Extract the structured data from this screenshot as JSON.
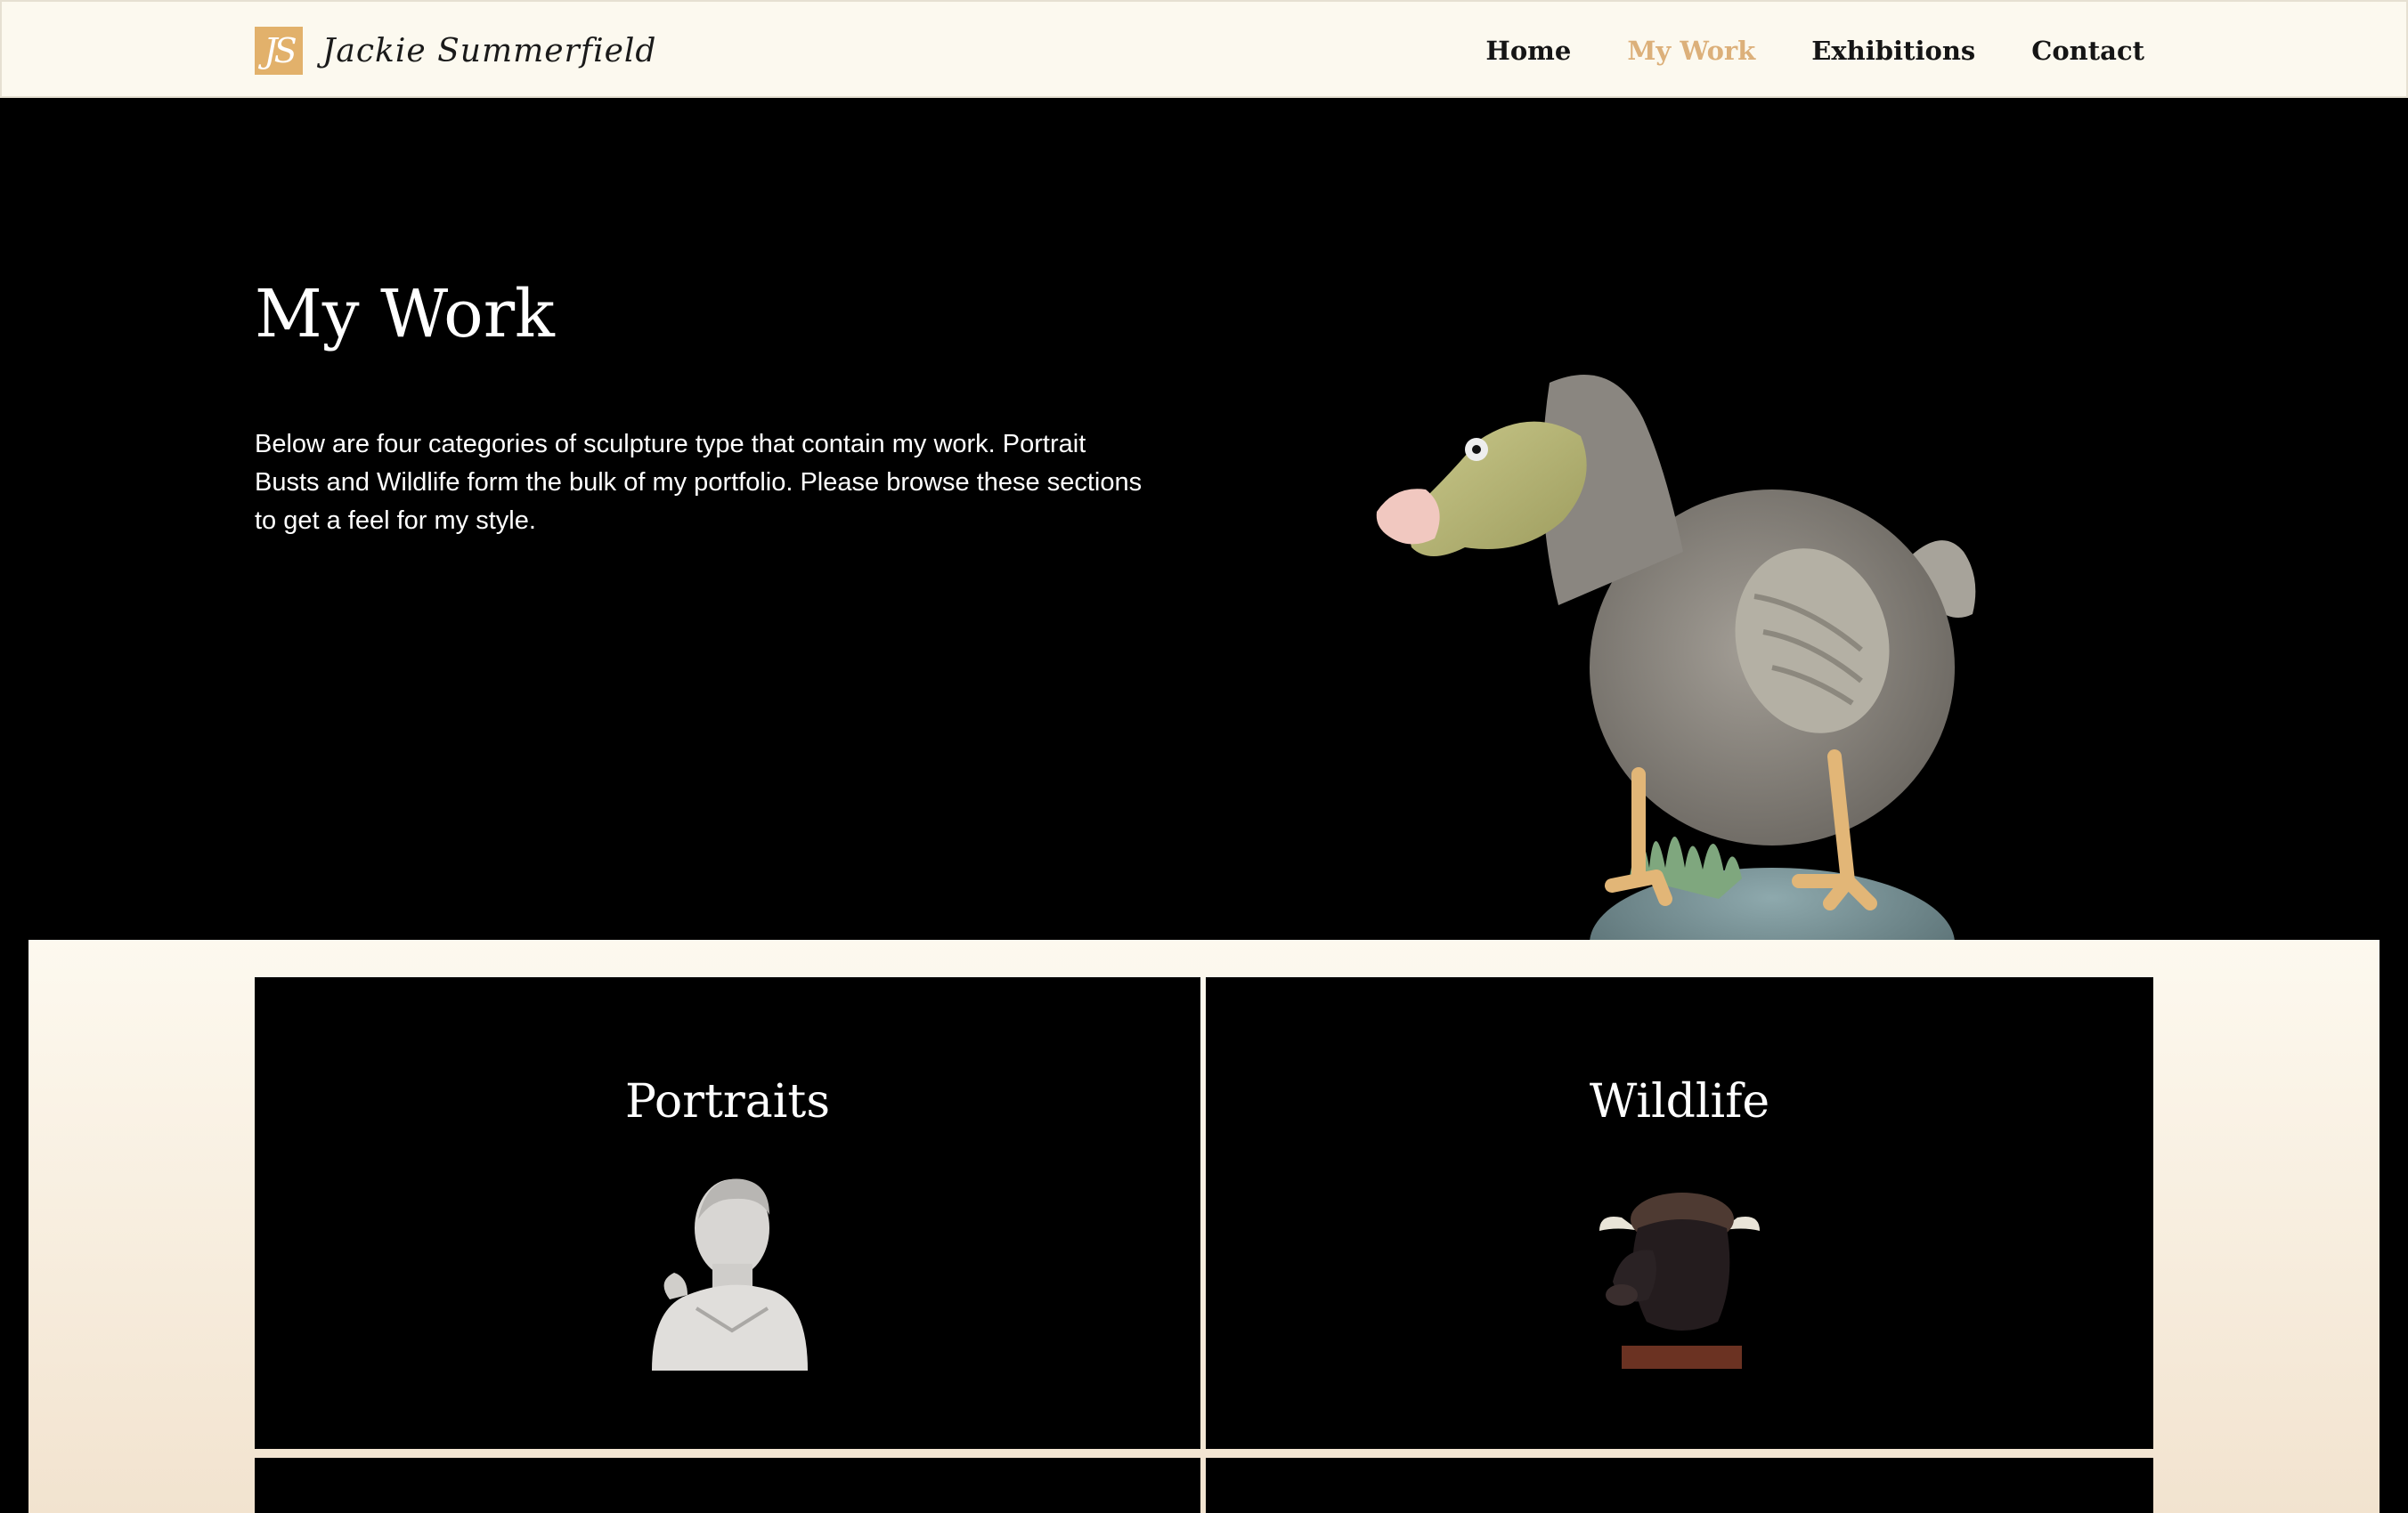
{
  "header": {
    "logo_mark": "JS",
    "logo_text": "Jackie Summerfield",
    "nav": [
      {
        "label": "Home",
        "active": false
      },
      {
        "label": "My Work",
        "active": true
      },
      {
        "label": "Exhibitions",
        "active": false
      },
      {
        "label": "Contact",
        "active": false
      }
    ],
    "accent_color": "#dcb07a"
  },
  "hero": {
    "title": "My Work",
    "description": "Below are four categories of sculpture type that contain my work. Portrait Busts and Wildlife form the bulk of my portfolio. Please browse these sections to get a feel for my style.",
    "image": "dodo-sculpture"
  },
  "categories": [
    {
      "title": "Portraits",
      "image": "portrait-bust-sculpture"
    },
    {
      "title": "Wildlife",
      "image": "bull-head-sculpture"
    },
    {
      "title": "",
      "image": ""
    },
    {
      "title": "",
      "image": ""
    }
  ]
}
